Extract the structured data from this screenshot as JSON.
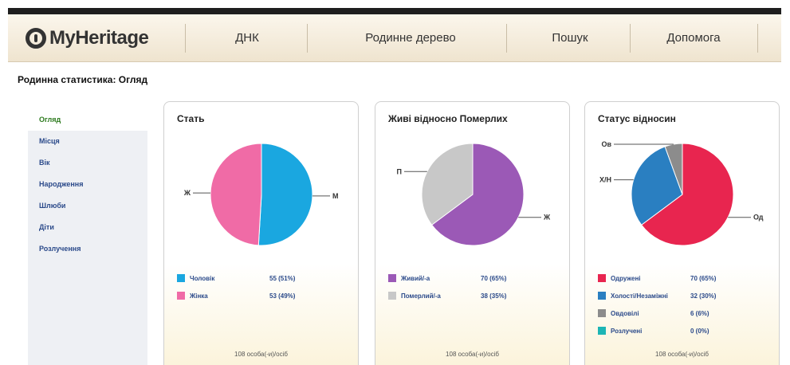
{
  "header": {
    "logo_text": "MyHeritage",
    "nav": [
      "ДНК",
      "Родинне дерево",
      "Пошук",
      "Допомога"
    ]
  },
  "page_title": "Родинна статистика: Огляд",
  "sidebar": {
    "items": [
      {
        "label": "Огляд",
        "active": true
      },
      {
        "label": "Місця",
        "active": false
      },
      {
        "label": "Вік",
        "active": false
      },
      {
        "label": "Народження",
        "active": false
      },
      {
        "label": "Шлюби",
        "active": false
      },
      {
        "label": "Діти",
        "active": false
      },
      {
        "label": "Розлучення",
        "active": false
      }
    ]
  },
  "chart_data": [
    {
      "type": "pie",
      "title": "Стать",
      "slices": [
        {
          "name": "Чоловік",
          "value": 55,
          "label": "55 (51%)",
          "pie_label": "M",
          "color": "#1aa7e0"
        },
        {
          "name": "Жінка",
          "value": 53,
          "label": "53 (49%)",
          "pie_label": "Ж",
          "color": "#f06ba6"
        }
      ],
      "footer": "108 особа(-и)/осіб"
    },
    {
      "type": "pie",
      "title": "Живі відносно Померлих",
      "slices": [
        {
          "name": "Живий/-а",
          "value": 70,
          "label": "70 (65%)",
          "pie_label": "Ж",
          "color": "#9b59b6"
        },
        {
          "name": "Померлий/-а",
          "value": 38,
          "label": "38 (35%)",
          "pie_label": "П",
          "color": "#c8c8c8"
        }
      ],
      "footer": "108 особа(-и)/осіб"
    },
    {
      "type": "pie",
      "title": "Статус відносин",
      "slices": [
        {
          "name": "Одружені",
          "value": 70,
          "label": "70 (65%)",
          "pie_label": "Од",
          "color": "#e8254f"
        },
        {
          "name": "Холості/Незаміжні",
          "value": 32,
          "label": "32 (30%)",
          "pie_label": "Х/Н",
          "color": "#2a7fc1"
        },
        {
          "name": "Овдовілі",
          "value": 6,
          "label": "6 (6%)",
          "pie_label": "Ов",
          "color": "#8c8c8c"
        },
        {
          "name": "Розлучені",
          "value": 0,
          "label": "0 (0%)",
          "pie_label": "",
          "color": "#1cb5b5"
        }
      ],
      "footer": "108 особа(-и)/осіб"
    }
  ]
}
